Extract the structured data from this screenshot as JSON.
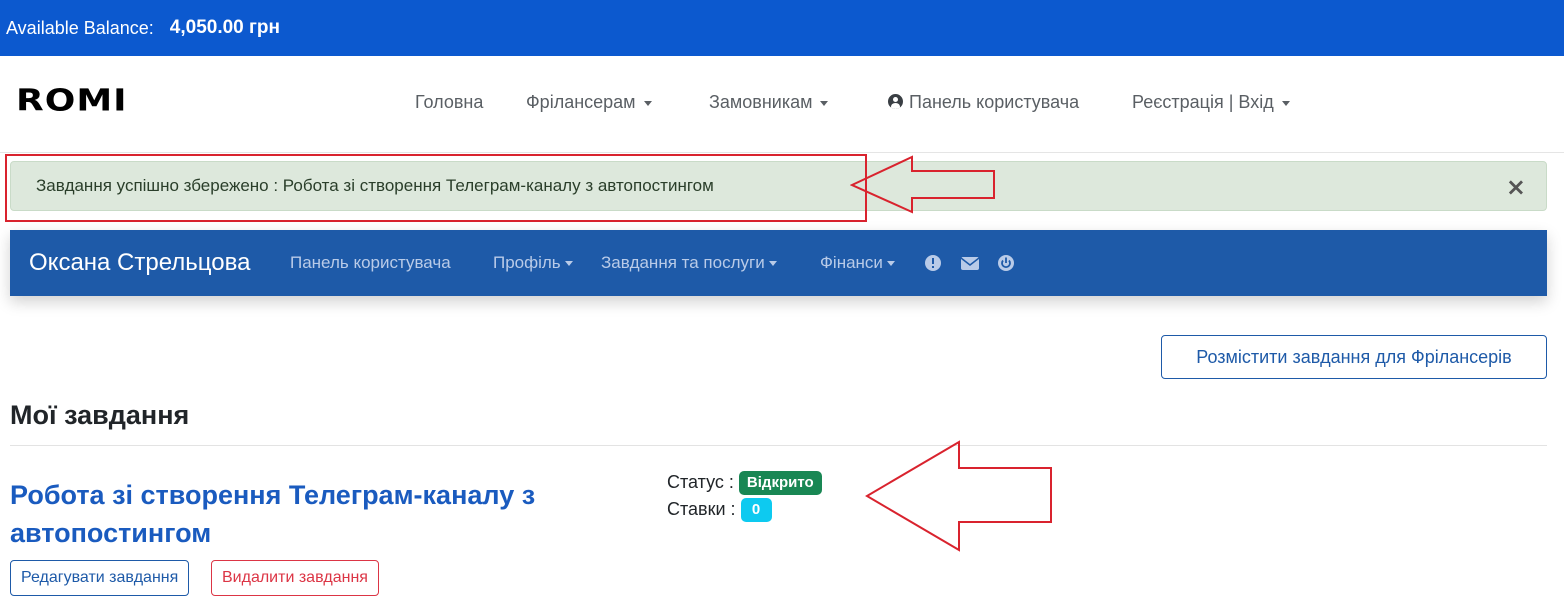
{
  "balance": {
    "label": "Available Balance:",
    "amount": "4,050.00 грн"
  },
  "logo": {
    "text": "ROMI"
  },
  "main_nav": {
    "home": "Головна",
    "freelancers": "Фрілансерам",
    "clients": "Замовникам",
    "user_panel": "Панель користувача",
    "auth": "Реєстрація | Вхід"
  },
  "alert": {
    "message": "Завдання успішно збережено : Робота зі створення Телеграм-каналу з автопостингом",
    "close": "×"
  },
  "user_nav": {
    "user_name": "Оксана Стрельцова",
    "panel": "Панель користувача",
    "profile": "Профіль",
    "tasks": "Завдання та послуги",
    "finance": "Фінанси"
  },
  "post_task_button": "Розмістити завдання для Фрілансерів",
  "section_title": "Мої завдання",
  "task": {
    "title": "Робота зі створення Телеграм-каналу з автопостингом",
    "status_label": "Статус :",
    "status_value": "Відкрито",
    "bids_label": "Ставки :",
    "bids_value": "0",
    "edit_label": "Редагувати завдання",
    "delete_label": "Видалити завдання"
  },
  "colors": {
    "balance_bar": "#0c59cf",
    "user_nav": "#1e5aa8",
    "alert_bg": "#dde8dc",
    "annotation_red": "#d9232e",
    "status_green": "#198754",
    "bids_cyan": "#0dcaf0"
  }
}
